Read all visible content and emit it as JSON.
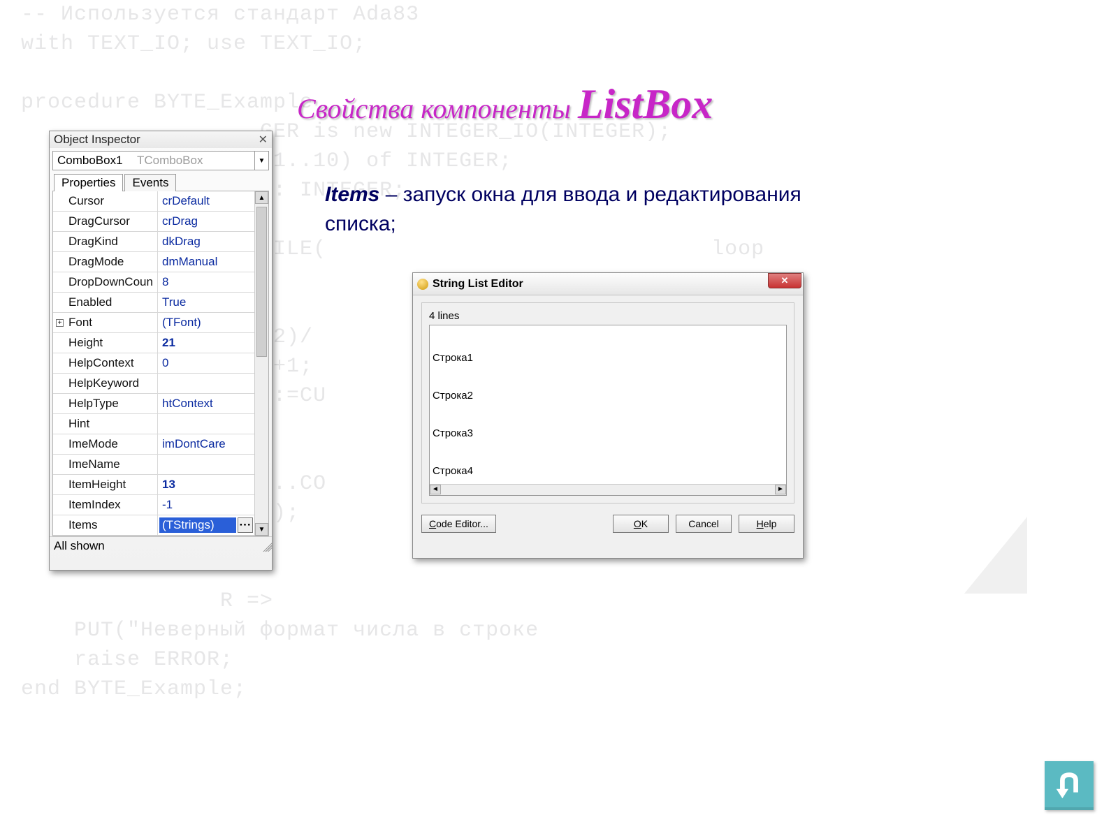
{
  "bg_code": "-- Используется стандарт Ada83\nwith TEXT_IO; use TEXT_IO;\n\nprocedure BYTE_Example\n                  GER is new INTEGER_IO(INTEGER);\n                  (1..10) of INTEGER;\n                  I: INTEGER;\n\n               OF_FILE(                             loop\n               );\n\n               mod 2)/\n               OUNT+1;\n               UNT):=CU\n\n\n               se 1..CO\n               S(I));\n\n\n               R =>\n    PUT(\"Неверный формат числа в строке\n    raise ERROR;\nend BYTE_Example;",
  "heading": {
    "prefix": "Свойства компоненты ",
    "big": "ListBox"
  },
  "desc": {
    "kw": "Items",
    "rest": " – запуск окна для ввода и редактирования списка;"
  },
  "oi": {
    "title": "Object Inspector",
    "close": "✕",
    "combo": {
      "name": "ComboBox1",
      "type": "TComboBox",
      "arrow": "▼"
    },
    "tabs": [
      "Properties",
      "Events"
    ],
    "rows": [
      {
        "name": "Cursor",
        "value": "crDefault"
      },
      {
        "name": "DragCursor",
        "value": "crDrag"
      },
      {
        "name": "DragKind",
        "value": "dkDrag"
      },
      {
        "name": "DragMode",
        "value": "dmManual"
      },
      {
        "name": "DropDownCoun",
        "value": "8"
      },
      {
        "name": "Enabled",
        "value": "True"
      },
      {
        "name": "Font",
        "value": "(TFont)",
        "expandable": true
      },
      {
        "name": "Height",
        "value": "21",
        "bold": true
      },
      {
        "name": "HelpContext",
        "value": "0"
      },
      {
        "name": "HelpKeyword",
        "value": ""
      },
      {
        "name": "HelpType",
        "value": "htContext"
      },
      {
        "name": "Hint",
        "value": ""
      },
      {
        "name": "ImeMode",
        "value": "imDontCare"
      },
      {
        "name": "ImeName",
        "value": ""
      },
      {
        "name": "ItemHeight",
        "value": "13",
        "bold": true
      },
      {
        "name": "ItemIndex",
        "value": "-1"
      },
      {
        "name": "Items",
        "value": "(TStrings)",
        "selected": true,
        "ellipsis": "···"
      }
    ],
    "status": "All shown"
  },
  "sle": {
    "title": "String List Editor",
    "label": "4 lines",
    "lines": [
      "Строка1",
      "Строка2",
      "Строка3",
      "Строка4"
    ],
    "buttons": {
      "code": "Code Editor...",
      "ok": "OK",
      "cancel": "Cancel",
      "help": "Help"
    },
    "close": "✕"
  }
}
